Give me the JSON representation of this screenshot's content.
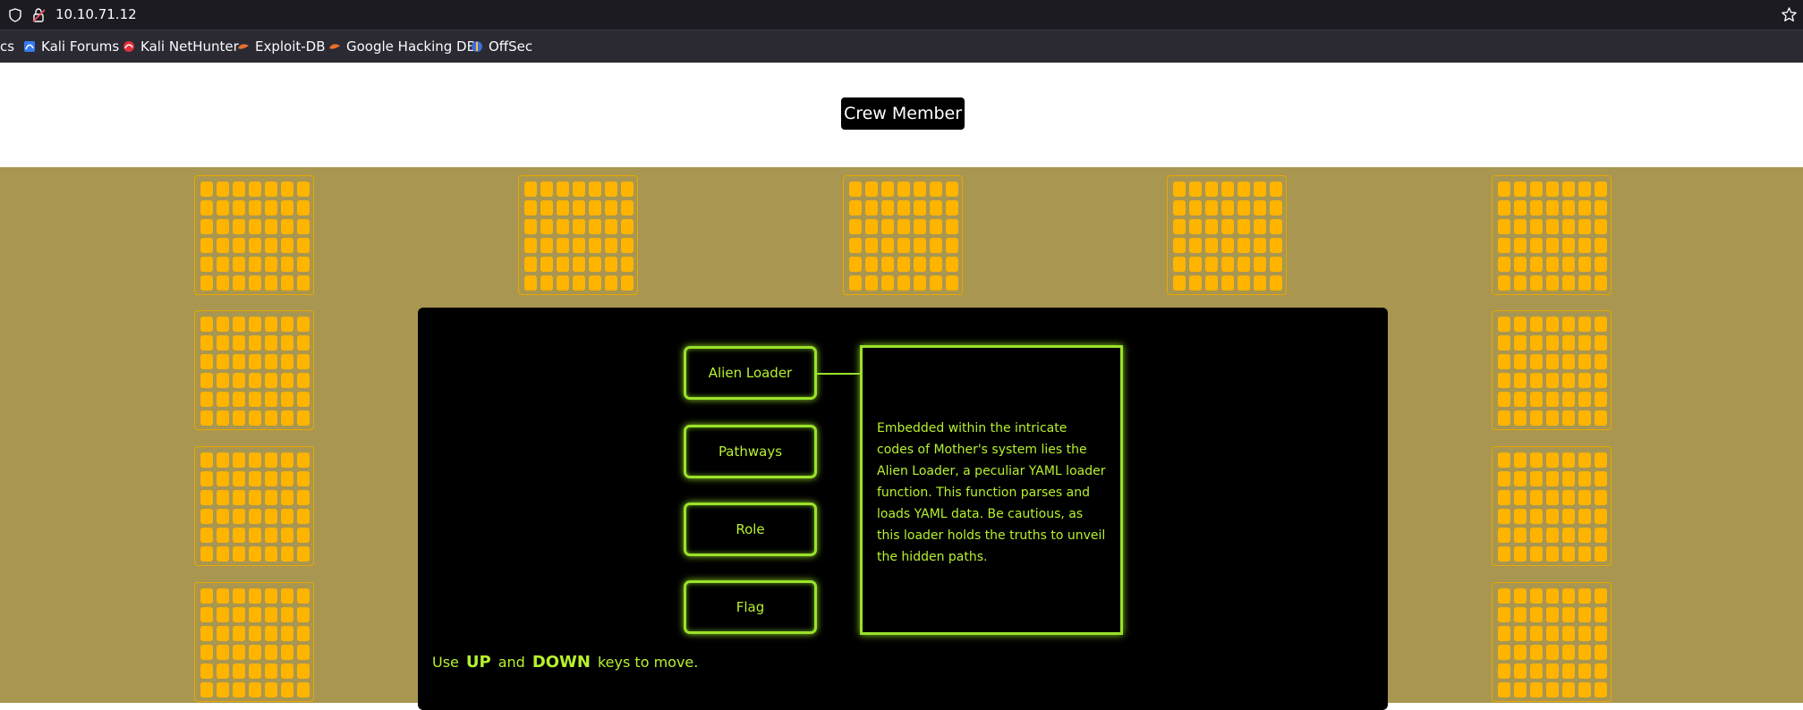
{
  "browser": {
    "url": "10.10.71.12",
    "bookmarks": [
      {
        "label": "cs",
        "icon": "none"
      },
      {
        "label": "Kali Forums",
        "icon": "kali-icon"
      },
      {
        "label": "Kali NetHunter",
        "icon": "nethunter-icon"
      },
      {
        "label": "Exploit-DB",
        "icon": "exploitdb-icon"
      },
      {
        "label": "Google Hacking DB",
        "icon": "ghdb-icon"
      },
      {
        "label": "OffSec",
        "icon": "offsec-icon"
      }
    ]
  },
  "header": {
    "crew_label": "Crew Member"
  },
  "console": {
    "menu": [
      {
        "label": "Alien Loader"
      },
      {
        "label": "Pathways"
      },
      {
        "label": "Role"
      },
      {
        "label": "Flag"
      }
    ],
    "description": "Embedded within the intricate codes of Mother's system lies the Alien Loader, a peculiar YAML loader function. This function parses and loads YAML data. Be cautious, as this loader holds the truths to unveil the hidden paths.",
    "hint": {
      "prefix": "Use",
      "key_up": "UP",
      "and": "and",
      "key_down": "DOWN",
      "suffix": "keys to move."
    }
  },
  "colors": {
    "background": "#a99650",
    "panel_light": "#ffb400",
    "accent_green": "#9ae22a",
    "console_bg": "#000000"
  }
}
